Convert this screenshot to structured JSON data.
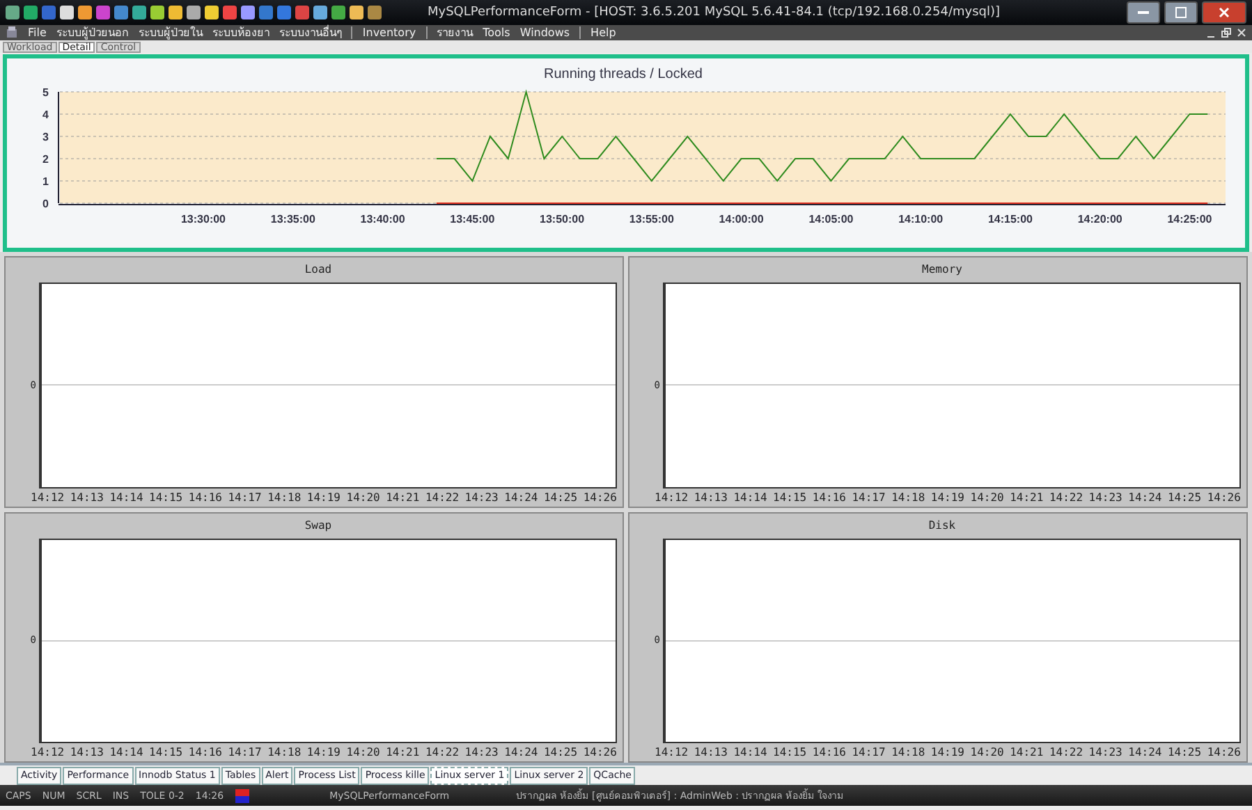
{
  "window": {
    "title": "MySQLPerformanceForm - [HOST: 3.6.5.201 MySQL 5.6.41-84.1 (tcp/192.168.0.254/mysql)]"
  },
  "menu": [
    "File",
    "ระบบผู้ป่วยนอก",
    "ระบบผู้ป่วยใน",
    "ระบบห้องยา",
    "ระบบงานอื่นๆ",
    "Inventory",
    "รายงาน",
    "Tools",
    "Windows",
    "Help"
  ],
  "top_tabs": [
    {
      "label": "Workload",
      "selected": false
    },
    {
      "label": "Detail",
      "selected": true
    },
    {
      "label": "Control",
      "selected": false
    }
  ],
  "main_chart": {
    "chart_data": {
      "type": "line",
      "title": "Running threads / Locked",
      "categories": [
        null,
        null,
        null,
        null,
        "13:30:00",
        null,
        null,
        null,
        null,
        "13:35:00",
        null,
        null,
        null,
        null,
        "13:40:00",
        null,
        null,
        null,
        null,
        "13:45:00",
        null,
        null,
        null,
        null,
        "13:50:00",
        null,
        null,
        null,
        null,
        "13:55:00",
        null,
        null,
        null,
        null,
        "14:00:00",
        null,
        null,
        null,
        null,
        "14:05:00",
        null,
        null,
        null,
        null,
        "14:10:00",
        null,
        null,
        null,
        null,
        "14:15:00",
        null,
        null,
        null,
        null,
        "14:20:00",
        null,
        null,
        null,
        null,
        "14:25:00",
        null
      ],
      "series": [
        {
          "color": "#2e8b1e",
          "values": [
            null,
            null,
            null,
            null,
            null,
            null,
            null,
            null,
            null,
            null,
            null,
            null,
            null,
            null,
            null,
            null,
            null,
            2,
            2,
            1,
            3,
            2,
            5,
            2,
            3,
            2,
            2,
            3,
            2,
            1,
            2,
            3,
            2,
            1,
            2,
            2,
            1,
            2,
            2,
            1,
            2,
            2,
            2,
            3,
            2,
            2,
            2,
            2,
            3,
            4,
            3,
            3,
            4,
            3,
            2,
            2,
            3,
            2,
            3,
            4,
            4
          ]
        },
        {
          "color": "#e03020",
          "values": [
            null,
            null,
            null,
            null,
            null,
            null,
            null,
            null,
            null,
            null,
            null,
            null,
            null,
            null,
            null,
            null,
            null,
            0,
            0,
            0,
            0,
            0,
            0,
            0,
            0,
            0,
            0,
            0,
            0,
            0,
            0,
            0,
            0,
            0,
            0,
            0,
            0,
            0,
            0,
            0,
            0,
            0,
            0,
            0,
            0,
            0,
            0,
            0,
            0,
            0,
            0,
            0,
            0,
            0,
            0,
            0,
            0,
            0,
            0,
            0,
            0
          ]
        }
      ],
      "ylim": [
        0,
        5
      ],
      "grid": true,
      "yticks": [
        0,
        1,
        2,
        3,
        4,
        5
      ]
    }
  },
  "panels": [
    {
      "title": "Load",
      "y_tick": "0",
      "x_ticks": [
        "14:12",
        "14:13",
        "14:14",
        "14:15",
        "14:16",
        "14:17",
        "14:18",
        "14:19",
        "14:20",
        "14:21",
        "14:22",
        "14:23",
        "14:24",
        "14:25",
        "14:26"
      ]
    },
    {
      "title": "Memory",
      "y_tick": "0",
      "x_ticks": [
        "14:12",
        "14:13",
        "14:14",
        "14:15",
        "14:16",
        "14:17",
        "14:18",
        "14:19",
        "14:20",
        "14:21",
        "14:22",
        "14:23",
        "14:24",
        "14:25",
        "14:26"
      ]
    },
    {
      "title": "Swap",
      "y_tick": "0",
      "x_ticks": [
        "14:12",
        "14:13",
        "14:14",
        "14:15",
        "14:16",
        "14:17",
        "14:18",
        "14:19",
        "14:20",
        "14:21",
        "14:22",
        "14:23",
        "14:24",
        "14:25",
        "14:26"
      ]
    },
    {
      "title": "Disk",
      "y_tick": "0",
      "x_ticks": [
        "14:12",
        "14:13",
        "14:14",
        "14:15",
        "14:16",
        "14:17",
        "14:18",
        "14:19",
        "14:20",
        "14:21",
        "14:22",
        "14:23",
        "14:24",
        "14:25",
        "14:26"
      ]
    }
  ],
  "bottom_tabs": [
    {
      "label": "Activity",
      "selected": false
    },
    {
      "label": "Performance",
      "selected": false
    },
    {
      "label": "Innodb Status 1",
      "selected": false
    },
    {
      "label": "Tables",
      "selected": false
    },
    {
      "label": "Alert",
      "selected": false
    },
    {
      "label": "Process List",
      "selected": false
    },
    {
      "label": "Process kille",
      "selected": false
    },
    {
      "label": "Linux server 1",
      "selected": true
    },
    {
      "label": "Linux server 2",
      "selected": false
    },
    {
      "label": "QCache",
      "selected": false
    }
  ],
  "status_bar": {
    "keys": [
      "CAPS",
      "NUM",
      "SCRL",
      "INS"
    ],
    "mode": "TOLE 0-2",
    "time": "14:26",
    "form": "MySQLPerformanceForm",
    "user": "ปรากฏผล ห้องยิ้ม [ศูนย์คอมพิวเตอร์] : AdminWeb : ปรากฏผล ห้องยิ้ม ใจงาม"
  }
}
